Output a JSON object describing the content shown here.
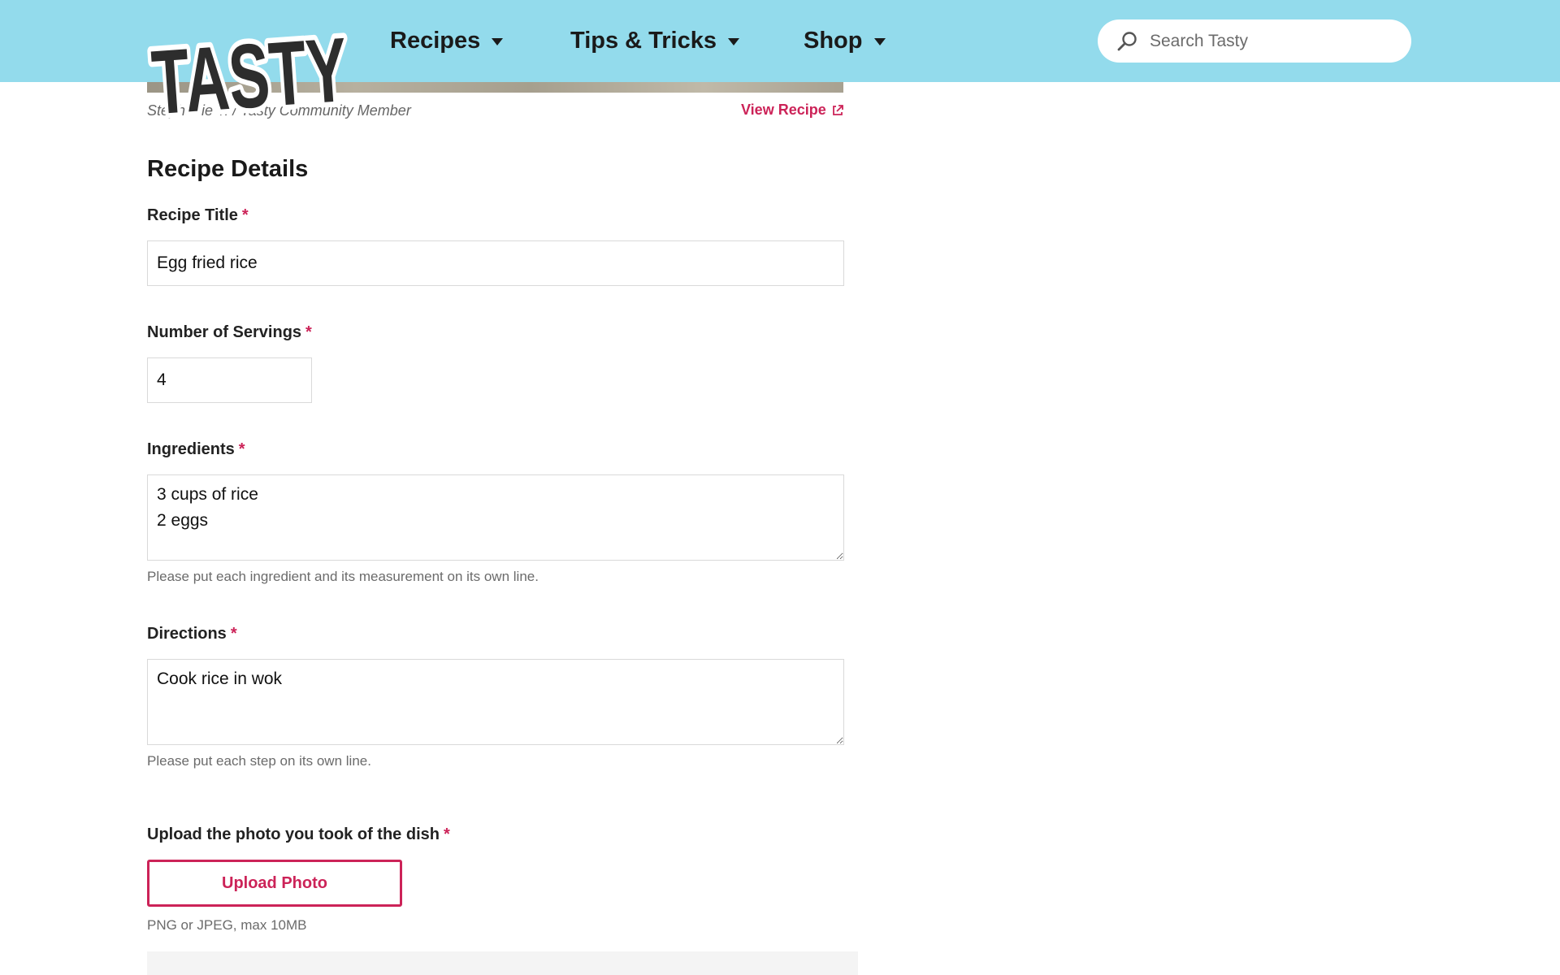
{
  "header": {
    "logo_text": "TASTY",
    "nav": [
      {
        "label": "Recipes"
      },
      {
        "label": "Tips & Tricks"
      },
      {
        "label": "Shop"
      }
    ],
    "search": {
      "placeholder": "Search Tasty",
      "value": ""
    }
  },
  "photo": {
    "credit": "Stephanie T. / Tasty Community Member",
    "view_recipe_label": "View Recipe"
  },
  "form": {
    "section_title": "Recipe Details",
    "required_mark": "*",
    "title_field": {
      "label": "Recipe Title",
      "value": "Egg fried rice"
    },
    "servings_field": {
      "label": "Number of Servings",
      "value": "4"
    },
    "ingredients_field": {
      "label": "Ingredients",
      "value": "3 cups of rice\n2 eggs",
      "help": "Please put each ingredient and its measurement on its own line."
    },
    "directions_field": {
      "label": "Directions",
      "value": "Cook rice in wok",
      "help": "Please put each step on its own line."
    },
    "photo_field": {
      "label": "Upload the photo you took of the dish",
      "button_label": "Upload Photo",
      "help": "PNG or JPEG, max 10MB"
    }
  },
  "colors": {
    "header_bg": "#93dbec",
    "accent": "#cc2358",
    "text": "#222222"
  },
  "icons": [
    "search-icon",
    "caret-down-icon",
    "external-link-icon"
  ]
}
